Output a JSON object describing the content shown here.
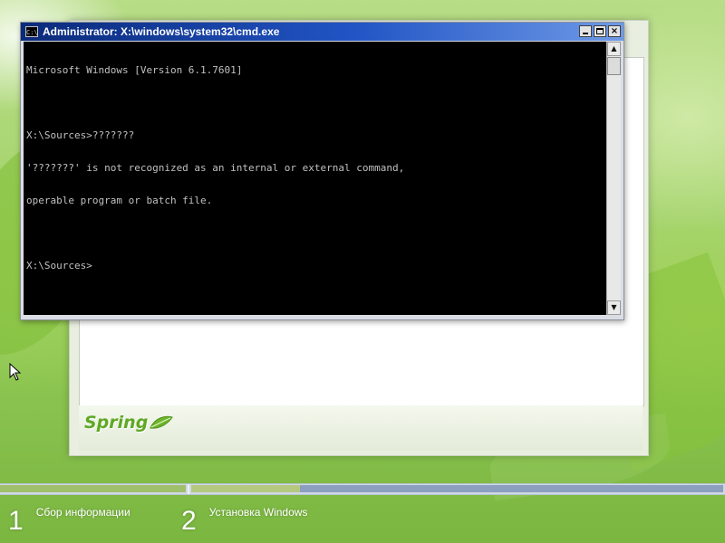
{
  "cmd": {
    "title": "Administrator: X:\\windows\\system32\\cmd.exe",
    "icon": "cmd-icon",
    "icon_text": "C:\\",
    "controls": {
      "minimize": "minimize-icon",
      "maximize": "maximize-icon",
      "close": "×"
    },
    "lines": [
      "Microsoft Windows [Version 6.1.7601]",
      "",
      "X:\\Sources>???????",
      "'???????' is not recognized as an internal or external command,",
      "operable program or batch file.",
      "",
      "X:\\Sources>"
    ],
    "scrollbar": {
      "up": "▲",
      "down": "▼"
    }
  },
  "setup": {
    "logo_text": "Spring",
    "logo_icon": "leaf-icon",
    "brand_color": "#5fa824"
  },
  "steps": [
    {
      "number": "1",
      "label": "Сбор информации"
    },
    {
      "number": "2",
      "label": "Установка Windows"
    }
  ],
  "colors": {
    "titlebar_start": "#0b2a7a",
    "titlebar_end": "#6f9ae6",
    "console_bg": "#000000",
    "console_fg": "#c0c0c0"
  }
}
